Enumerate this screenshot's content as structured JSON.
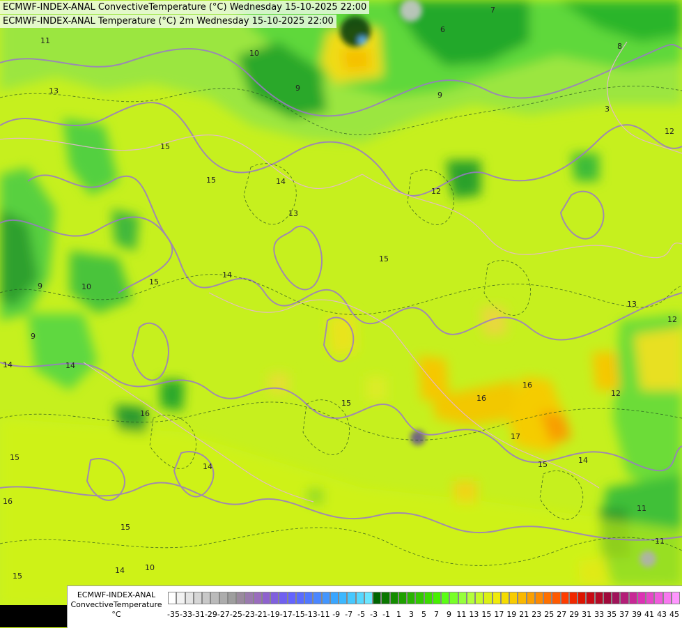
{
  "header": {
    "line1": "ECMWF-INDEX-ANAL ConvectiveTemperature (°C) Wednesday 15-10-2025 22:00",
    "line2": "ECMWF-INDEX-ANAL Temperature (°C) 2m Wednesday 15-10-2025 22:00"
  },
  "legend": {
    "title_line1": "ECMWF-INDEX-ANAL",
    "title_line2": "ConvectiveTemperature",
    "title_line3": "°C",
    "ticks": [
      "-35",
      "-33",
      "-31",
      "-29",
      "-27",
      "-25",
      "-23",
      "-21",
      "-19",
      "-17",
      "-15",
      "-13",
      "-11",
      "-9",
      "-7",
      "-5",
      "-3",
      "-1",
      "1",
      "3",
      "5",
      "7",
      "9",
      "11",
      "13",
      "15",
      "17",
      "19",
      "21",
      "23",
      "25",
      "27",
      "29",
      "31",
      "33",
      "35",
      "37",
      "39",
      "41",
      "43",
      "45"
    ],
    "colors": [
      "#ffffff",
      "#f2f2f2",
      "#e4e4e4",
      "#d6d6d6",
      "#c8c8c8",
      "#bababa",
      "#acacac",
      "#9e9e9e",
      "#9a8a9e",
      "#9a7aae",
      "#9a6cbe",
      "#8e62ce",
      "#8060de",
      "#7060f0",
      "#6464ff",
      "#5a6cff",
      "#5078ff",
      "#4a86ff",
      "#4296ff",
      "#3aa6ff",
      "#3cb8ff",
      "#46c8ff",
      "#56d8ff",
      "#6ae6ff",
      "#006400",
      "#0a7800",
      "#148c00",
      "#1ea000",
      "#28b400",
      "#32c800",
      "#3cdc00",
      "#46f000",
      "#5aff14",
      "#78ff28",
      "#96ff3c",
      "#b4ff3c",
      "#c8fa28",
      "#dcf014",
      "#f0eb0a",
      "#f5dc00",
      "#f8cc00",
      "#fab800",
      "#fca000",
      "#fd8a00",
      "#fe7000",
      "#ff5a00",
      "#ff3c00",
      "#f02800",
      "#dc1400",
      "#c80a14",
      "#b40a28",
      "#a00a3c",
      "#a0145a",
      "#b41e78",
      "#c82896",
      "#dc32b4",
      "#e646c8",
      "#f05adc",
      "#f878f0",
      "#ff96ff"
    ]
  }
}
